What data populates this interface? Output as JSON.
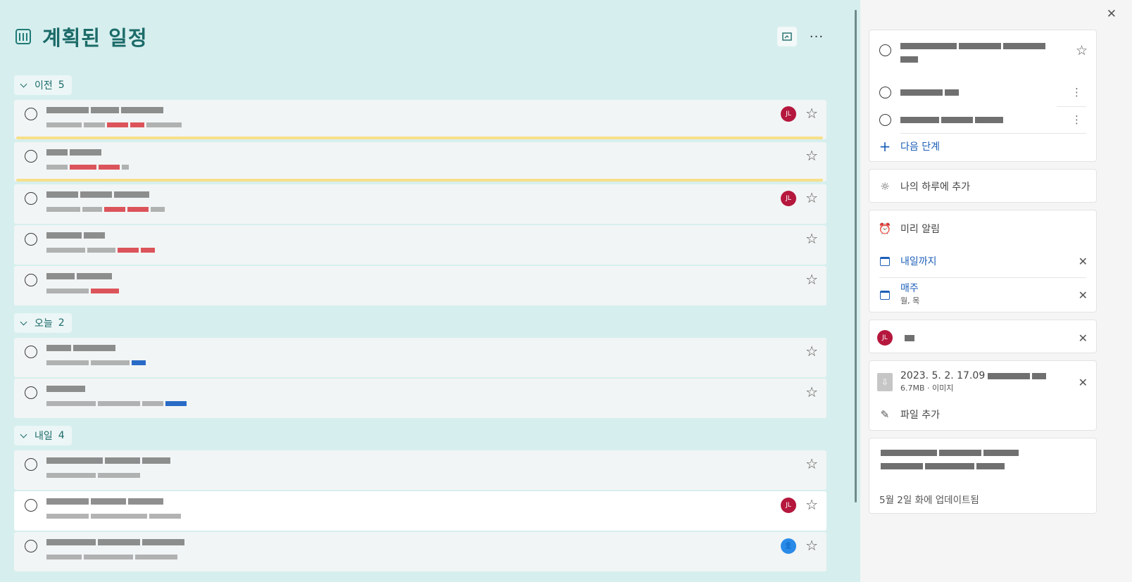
{
  "app": {
    "title": "계획된 일정",
    "header_more": "···"
  },
  "groups": [
    {
      "label": "이전",
      "count": "5"
    },
    {
      "label": "오늘",
      "count": "2"
    },
    {
      "label": "내일",
      "count": "4"
    }
  ],
  "avatar": {
    "initials": "JL"
  },
  "icons": {
    "star": "☆",
    "close": "✕",
    "plus": "+",
    "kebab": "⋮",
    "sun": "☼",
    "clock": "⏰",
    "clip": "✎",
    "download": "⇩",
    "person": "👤"
  },
  "detail": {
    "add_step": "다음 단계",
    "my_day": "나의 하루에 추가",
    "remind": "미리 알림",
    "due": "내일까지",
    "repeat": "매주",
    "repeat_days": "월, 목",
    "file_name": "2023. 5. 2. 17.09",
    "file_meta": "6.7MB · 이미지",
    "add_file": "파일 추가",
    "updated": "5월 2일 화에 업데이트됨"
  },
  "colors": {
    "accent": "#1c6b69",
    "background": "#d6efee",
    "avatar": "#b5173d",
    "link_blue": "#1c5fb8",
    "due_highlight": "#f6e08a"
  }
}
